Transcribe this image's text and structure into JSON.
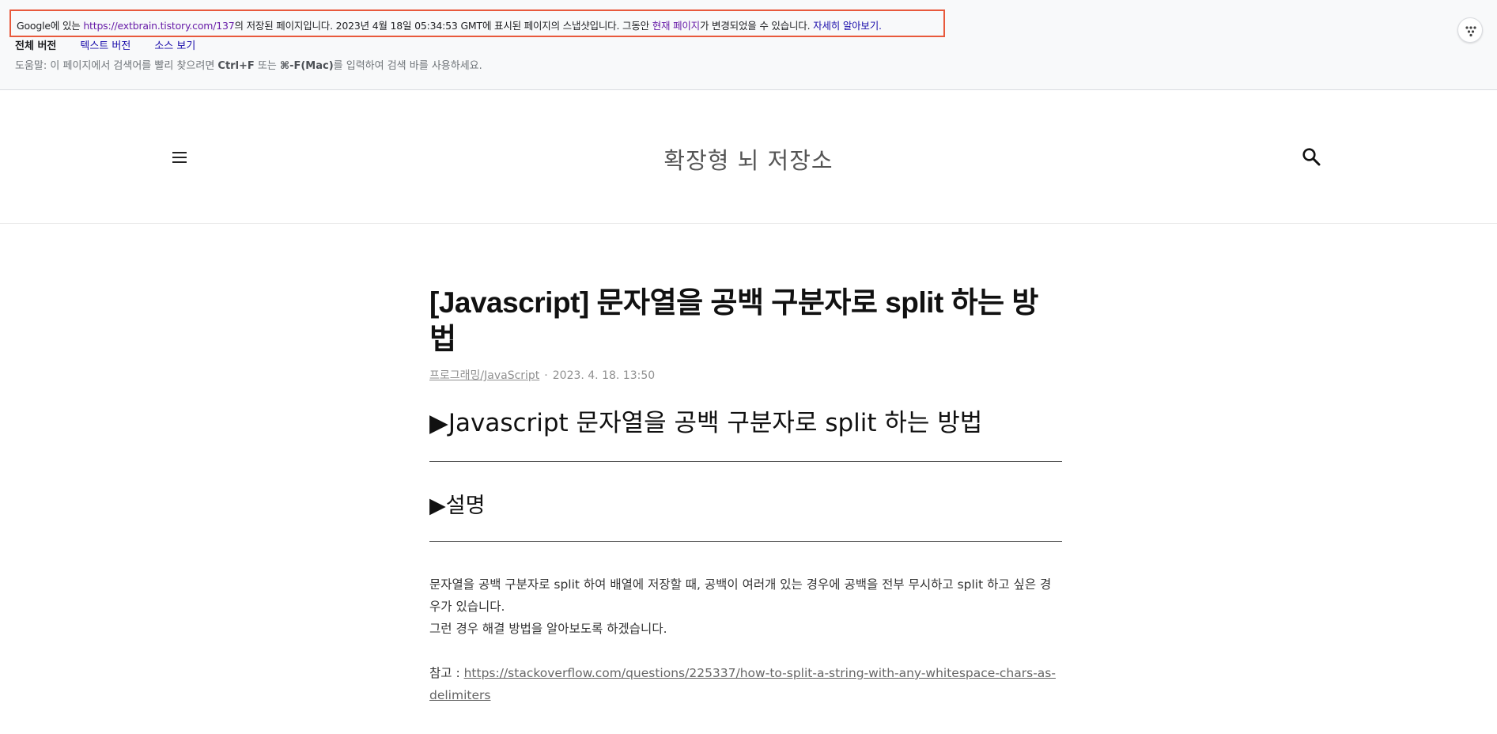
{
  "cache_banner": {
    "notice_prefix": "Google에 있는 ",
    "cached_url": "https://extbrain.tistory.com/137",
    "notice_middle": "의 저장된 페이지입니다. 2023년 4월 18일 05:34:53 GMT에 표시된 페이지의 스냅샷입니다. 그동안 ",
    "current_page_link": "현재 페이지",
    "notice_suffix": "가 변경되었을 수 있습니다. ",
    "learn_more_link": "자세히 알아보기.",
    "tabs": [
      {
        "label": "전체 버전",
        "active": true
      },
      {
        "label": "텍스트 버전",
        "active": false
      },
      {
        "label": "소스 보기",
        "active": false
      }
    ],
    "help_prefix": "도움말: 이 페이지에서 검색어를 빨리 찾으려면 ",
    "help_shortcut_1": "Ctrl+F",
    "help_middle": " 또는 ",
    "help_shortcut_2": "⌘-F(Mac)",
    "help_suffix": "를 입력하여 검색 바를 사용하세요.",
    "more_icon": "more-options-icon"
  },
  "blog_header": {
    "menu_icon": "hamburger-menu-icon",
    "title": "확장형 뇌 저장소",
    "search_icon": "search-icon"
  },
  "article": {
    "title": "[Javascript] 문자열을 공백 구분자로 split 하는 방법",
    "category": "프로그래밍/JavaScript",
    "separator": "·",
    "date": "2023. 4. 18. 13:50",
    "heading_1": "▶Javascript 문자열을 공백 구분자로 split 하는 방법",
    "heading_2": "▶설명",
    "paragraph_1": "문자열을 공백 구분자로 split 하여 배열에 저장할 때, 공백이 여러개 있는 경우에 공백을 전부 무시하고 split 하고 싶은 경우가 있습니다.",
    "paragraph_2": "그런 경우 해결 방법을 알아보도록 하겠습니다.",
    "reference_label": "참고 : ",
    "reference_link": "https://stackoverflow.com/questions/225337/how-to-split-a-string-with-any-whitespace-chars-as-delimiters"
  },
  "colors": {
    "notice_border": "#e8593c",
    "link_blue": "#1a0dab",
    "link_visited": "#681da8",
    "banner_bg": "#f8f9fa"
  }
}
